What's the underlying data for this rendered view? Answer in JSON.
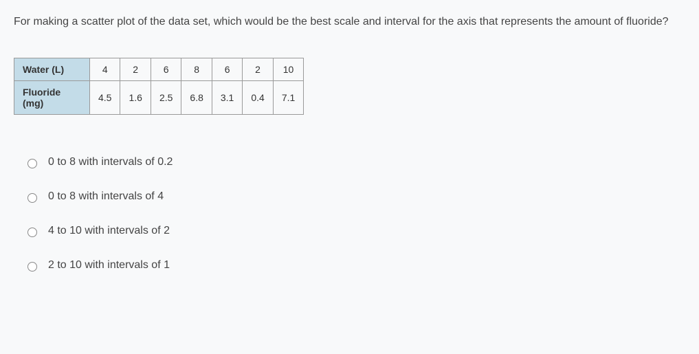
{
  "question": "For making a scatter plot of the data set, which would be the best scale and interval for the axis that represents the amount of fluoride?",
  "table": {
    "rows": [
      {
        "header": "Water (L)",
        "cells": [
          "4",
          "2",
          "6",
          "8",
          "6",
          "2",
          "10"
        ]
      },
      {
        "header": "Fluoride (mg)",
        "cells": [
          "4.5",
          "1.6",
          "2.5",
          "6.8",
          "3.1",
          "0.4",
          "7.1"
        ]
      }
    ]
  },
  "options": [
    "0 to 8 with intervals of 0.2",
    "0 to 8 with intervals of 4",
    "4 to 10 with intervals of 2",
    "2 to 10 with intervals of 1"
  ]
}
